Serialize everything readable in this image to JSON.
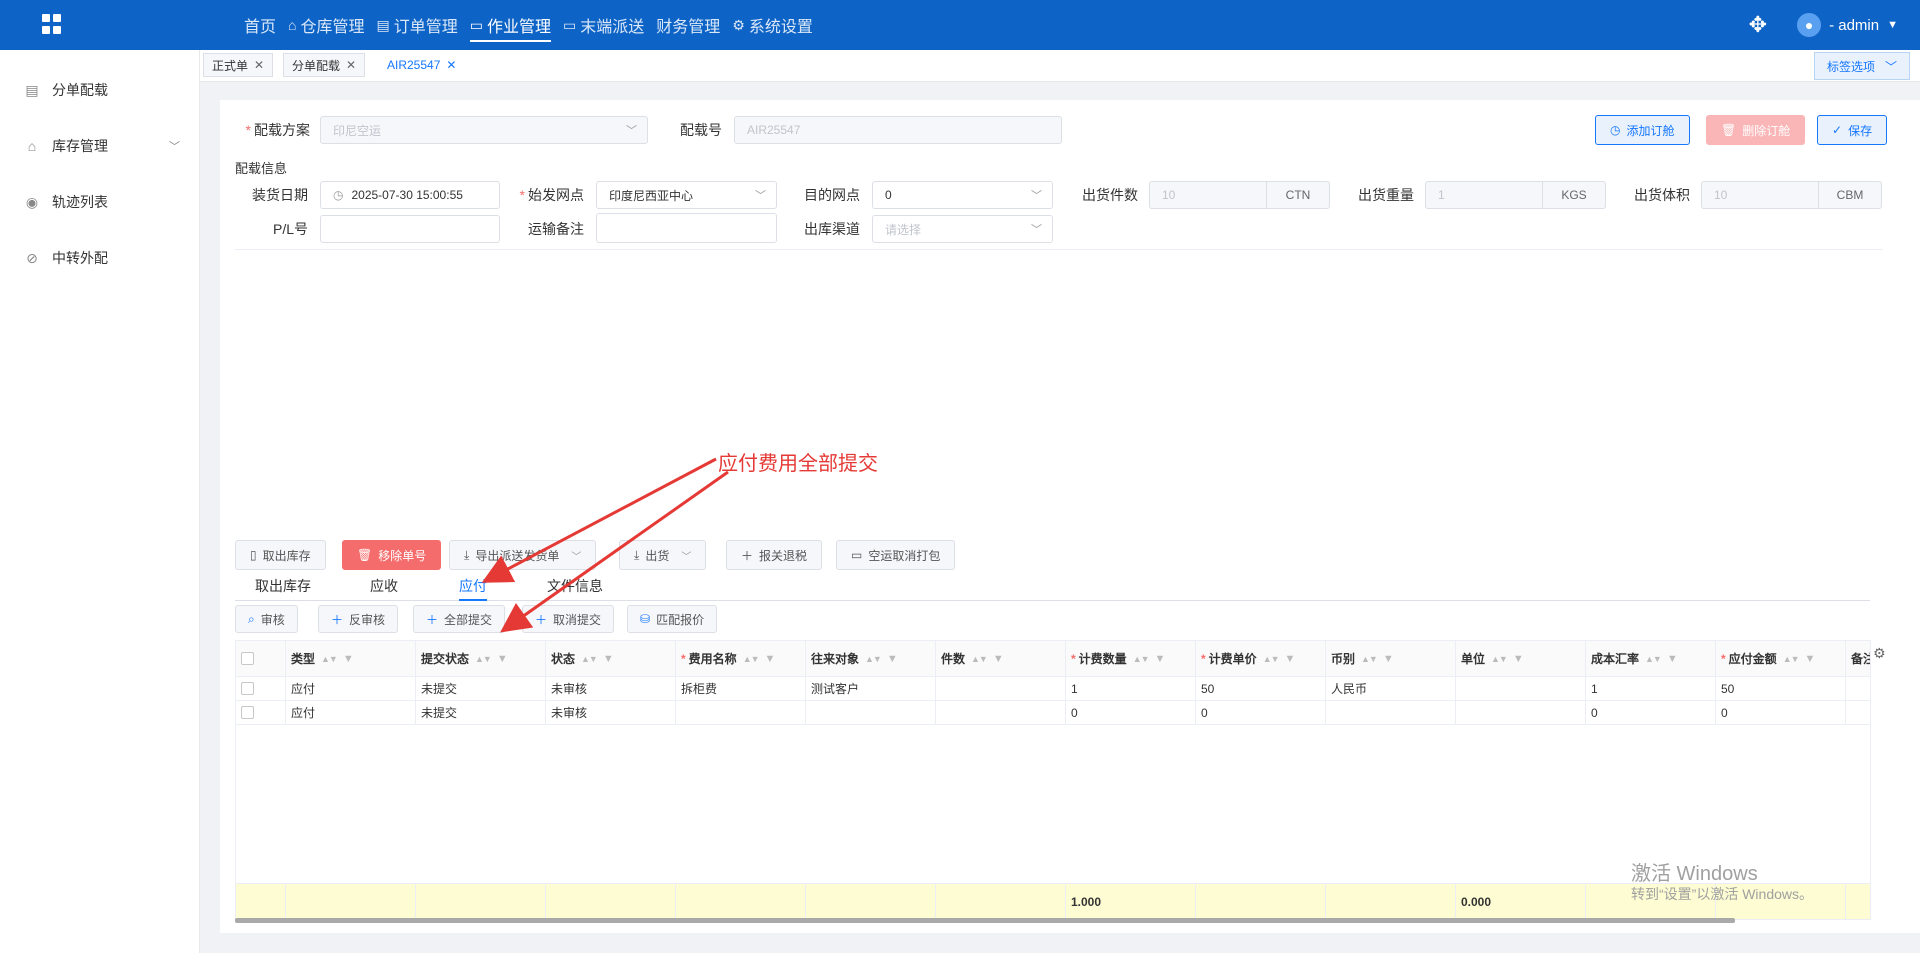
{
  "topnav": {
    "items": [
      {
        "label": "首页",
        "icon": ""
      },
      {
        "label": "仓库管理",
        "icon": "home-icon"
      },
      {
        "label": "订单管理",
        "icon": "doc-icon"
      },
      {
        "label": "作业管理",
        "icon": "folder-icon"
      },
      {
        "label": "末端派送",
        "icon": "folder-icon"
      },
      {
        "label": "财务管理",
        "icon": ""
      },
      {
        "label": "系统设置",
        "icon": "gear-icon"
      }
    ],
    "active": "作业管理",
    "user": "- admin"
  },
  "sidebar": {
    "items": [
      {
        "label": "分单配载",
        "icon": "list-icon"
      },
      {
        "label": "库存管理",
        "icon": "bag-icon"
      },
      {
        "label": "轨迹列表",
        "icon": "location-icon"
      },
      {
        "label": "中转外配",
        "icon": "link-icon"
      }
    ]
  },
  "tabs": {
    "items": [
      "正式单",
      "分单配载",
      "AIR25547"
    ],
    "active": "AIR25547",
    "options_label": "标签选项"
  },
  "form": {
    "plan_label": "配载方案",
    "plan_value": "印尼空运",
    "no_label": "配载号",
    "no_value": "AIR25547",
    "section_title": "配载信息",
    "load_date_label": "装货日期",
    "load_date_value": "2025-07-30 15:00:55",
    "origin_label": "始发网点",
    "origin_value": "印度尼西亚中心",
    "dest_label": "目的网点",
    "dest_value": "0",
    "qty_label": "出货件数",
    "qty_value": "10",
    "qty_unit": "CTN",
    "weight_label": "出货重量",
    "weight_value": "1",
    "weight_unit": "KGS",
    "volume_label": "出货体积",
    "volume_value": "10",
    "volume_unit": "CBM",
    "pl_label": "P/L号",
    "pl_value": "",
    "remark_label": "运输备注",
    "channel_label": "出库渠道",
    "channel_placeholder": "请选择"
  },
  "header_buttons": {
    "add_order": "添加订舱",
    "delete_order": "删除订舱",
    "save": "保存"
  },
  "toolbar": {
    "cancel_stock": "取出库存",
    "remove_no": "移除单号",
    "export": "导出派送发货单",
    "ship": "出货",
    "customs_refund": "报关退税",
    "cancel_pack": "空运取消打包"
  },
  "subtabs": {
    "items": [
      "取出库存",
      "应收",
      "应付",
      "文件信息"
    ],
    "active": "应付"
  },
  "sub_toolbar": {
    "audit": "审核",
    "unaudit": "反审核",
    "submit_all": "全部提交",
    "cancel_submit": "取消提交",
    "match_quote": "匹配报价"
  },
  "table": {
    "columns": [
      {
        "label": "类型",
        "required": false
      },
      {
        "label": "提交状态",
        "required": false
      },
      {
        "label": "状态",
        "required": false
      },
      {
        "label": "费用名称",
        "required": true
      },
      {
        "label": "往来对象",
        "required": false
      },
      {
        "label": "件数",
        "required": false
      },
      {
        "label": "计费数量",
        "required": true
      },
      {
        "label": "计费单价",
        "required": true
      },
      {
        "label": "币别",
        "required": false
      },
      {
        "label": "单位",
        "required": false
      },
      {
        "label": "成本汇率",
        "required": false
      },
      {
        "label": "应付金额",
        "required": true
      },
      {
        "label": "备注",
        "required": false
      }
    ],
    "rows": [
      [
        "应付",
        "未提交",
        "未审核",
        "拆柜费",
        "测试客户",
        "",
        "1",
        "50",
        "人民币",
        "",
        "1",
        "50",
        ""
      ],
      [
        "应付",
        "未提交",
        "未审核",
        "",
        "",
        "",
        "0",
        "0",
        "",
        "",
        "0",
        "0",
        ""
      ]
    ],
    "summary": [
      "",
      "",
      "",
      "",
      "",
      "",
      "1.000",
      "",
      "",
      "0.000",
      "",
      "",
      ""
    ]
  },
  "annotation": {
    "text": "应付费用全部提交",
    "color": "#e53935"
  },
  "watermark": {
    "line1": "激活 Windows",
    "line2": "转到“设置”以激活 Windows。"
  }
}
